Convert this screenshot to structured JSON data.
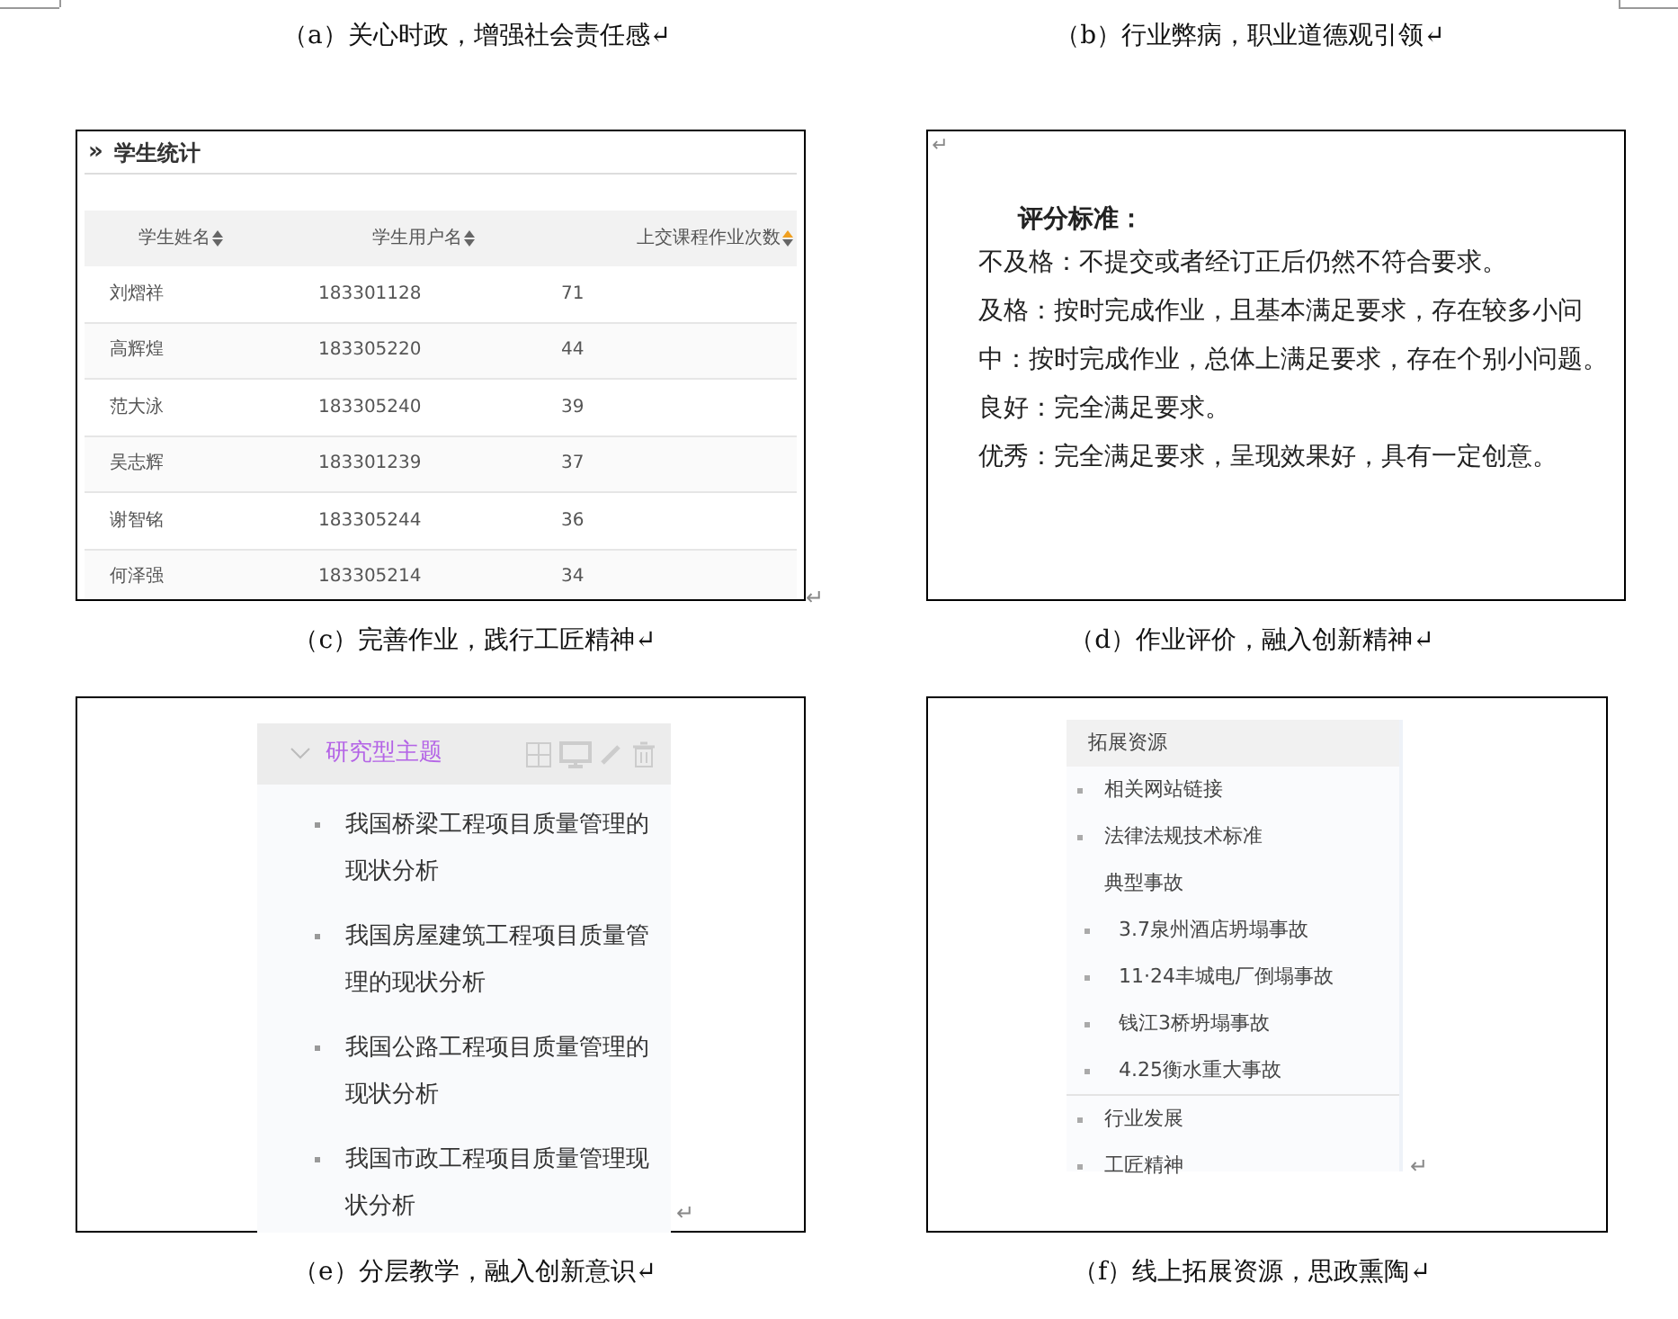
{
  "captions_top": [
    "（a）关心时政，增强社会责任感↵",
    "（b）行业弊病，职业道德观引领↵"
  ],
  "figures": [
    {
      "kind": "table",
      "title_icon": "»",
      "title": "学生统计",
      "columns": [
        {
          "label": "学生姓名",
          "sorted": false
        },
        {
          "label": "学生用户名",
          "sorted": false
        },
        {
          "label": "上交课程作业次数",
          "sorted": true
        }
      ],
      "rows": [
        [
          "刘熠祥",
          "183301128",
          "71"
        ],
        [
          "高辉煌",
          "183305220",
          "44"
        ],
        [
          "范大泳",
          "183305240",
          "39"
        ],
        [
          "吴志辉",
          "183301239",
          "37"
        ],
        [
          "谢智铭",
          "183305244",
          "36"
        ],
        [
          "何泽强",
          "183305214",
          "34"
        ]
      ],
      "mark": "↵",
      "caption": "（c）完善作业，践行工匠精神↵"
    },
    {
      "kind": "text",
      "mark": "↵",
      "heading": "评分标准：",
      "lines": [
        "不及格：不提交或者经订正后仍然不符合要求。",
        "及格：按时完成作业，且基本满足要求，存在较多小问",
        "中：按时完成作业，总体上满足要求，存在个别小问题。",
        "良好：完全满足要求。",
        "优秀：完全满足要求，呈现效果好，具有一定创意。"
      ],
      "caption": "（d）作业评价，融入创新精神↵"
    },
    {
      "kind": "tree",
      "title": "研究型主题",
      "expanded": true,
      "items": [
        "我国桥梁工程项目质量管理的现状分析",
        "我国房屋建筑工程项目质量管理的现状分析",
        "我国公路工程项目质量管理的现状分析",
        "我国市政工程项目质量管理现状分析"
      ],
      "mark": "↵",
      "caption": "（e）分层教学，融入创新意识↵"
    },
    {
      "kind": "resources",
      "title": "拓展资源",
      "items": [
        {
          "label": "相关网站链接"
        },
        {
          "label": "法律法规技术标准"
        },
        {
          "label": "典型事故",
          "children": [
            {
              "label": "3.7泉州酒店坍塌事故"
            },
            {
              "label": "11·24丰城电厂倒塌事故"
            },
            {
              "label": "钱江3桥坍塌事故"
            },
            {
              "label": "4.25衡水重大事故"
            }
          ]
        },
        {
          "label": "行业发展"
        },
        {
          "label": "工匠精神"
        }
      ],
      "mark": "↵",
      "caption": "（f）线上拓展资源，思政熏陶↵"
    }
  ]
}
